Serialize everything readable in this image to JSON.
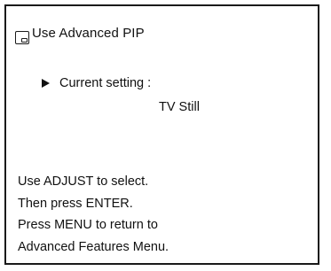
{
  "menu": {
    "title": "Use Advanced PIP",
    "icon": "pip-window-icon",
    "current_setting_label": "Current setting :",
    "current_setting_value": "TV Still",
    "instructions": [
      "Use ADJUST to select.",
      "Then press ENTER.",
      "Press MENU to return to",
      "Advanced Features Menu."
    ]
  }
}
